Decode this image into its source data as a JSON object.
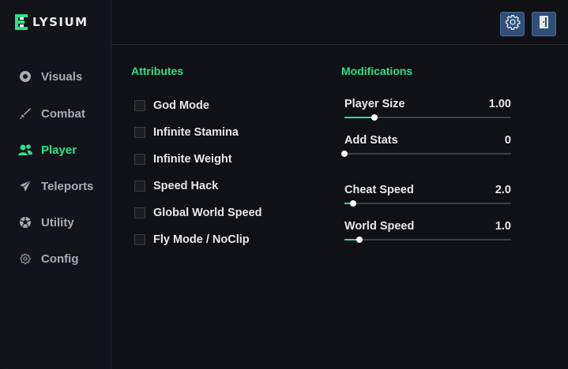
{
  "app": {
    "logo_text": "LYSIUM",
    "logo_icon": "elysium-e-logo",
    "accent": "#2fe08a"
  },
  "sidebar": {
    "items": [
      {
        "label": "Visuals",
        "icon": "eye-icon",
        "active": false
      },
      {
        "label": "Combat",
        "icon": "sword-icon",
        "active": false
      },
      {
        "label": "Player",
        "icon": "users-icon",
        "active": true
      },
      {
        "label": "Teleports",
        "icon": "paper-plane-icon",
        "active": false
      },
      {
        "label": "Utility",
        "icon": "soccer-ball-icon",
        "active": false
      },
      {
        "label": "Config",
        "icon": "gear-icon",
        "active": false
      }
    ]
  },
  "topbar": {
    "settings_icon": "gear-icon",
    "exit_icon": "door-exit-icon"
  },
  "attributes": {
    "title": "Attributes",
    "items": [
      {
        "label": "God Mode",
        "checked": false
      },
      {
        "label": "Infinite Stamina",
        "checked": false
      },
      {
        "label": "Infinite Weight",
        "checked": false
      },
      {
        "label": "Speed Hack",
        "checked": false
      },
      {
        "label": "Global World Speed",
        "checked": false
      },
      {
        "label": "Fly Mode / NoClip",
        "checked": false
      }
    ]
  },
  "modifications": {
    "title": "Modifications",
    "sliders": [
      {
        "label": "Player Size",
        "value": "1.00",
        "fraction": 0.18
      },
      {
        "label": "Add Stats",
        "value": "0",
        "fraction": 0.0
      },
      {
        "label": "Cheat Speed",
        "value": "2.0",
        "fraction": 0.05
      },
      {
        "label": "World Speed",
        "value": "1.0",
        "fraction": 0.09
      }
    ]
  }
}
